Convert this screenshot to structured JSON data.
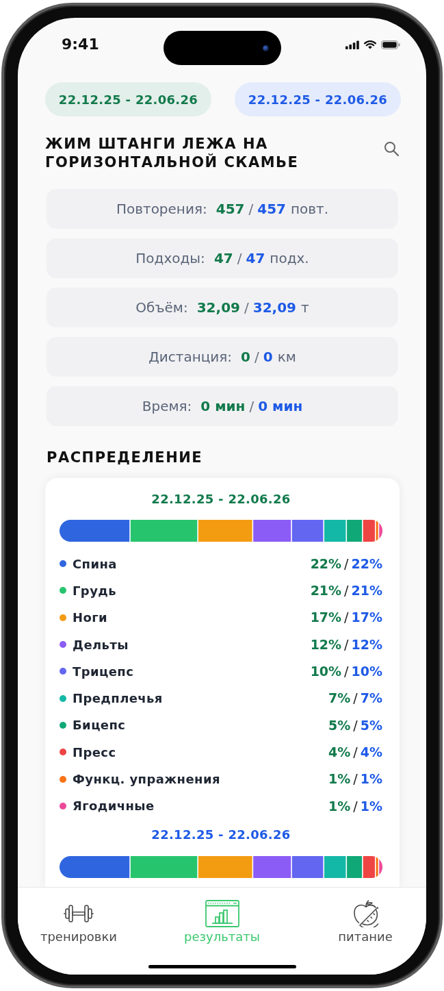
{
  "status_bar": {
    "time": "9:41"
  },
  "periods": [
    {
      "label": "22.12.25 - 22.06.26",
      "color": "#127a4c"
    },
    {
      "label": "22.12.25 - 22.06.26",
      "color": "#1e5ae6"
    }
  ],
  "exercise": {
    "title": "ЖИМ ШТАНГИ ЛЕЖА НА ГОРИЗОНТАЛЬНОЙ СКАМЬЕ"
  },
  "stats": [
    {
      "label": "Повторения:",
      "value_1": "457",
      "separator": "/",
      "value_2": "457",
      "unit": "повт."
    },
    {
      "label": "Подходы:",
      "value_1": "47",
      "separator": "/",
      "value_2": "47",
      "unit": "подх."
    },
    {
      "label": "Объём:",
      "value_1": "32,09",
      "separator": "/",
      "value_2": "32,09",
      "unit": "т"
    },
    {
      "label": "Дистанция:",
      "value_1": "0",
      "separator": "/",
      "value_2": "0",
      "unit": "км"
    },
    {
      "label": "Время:",
      "value_1": "0 мин",
      "separator": "/",
      "value_2": "0 мин"
    }
  ],
  "distribution": {
    "title": "РАСПРЕДЕЛЕНИЕ",
    "blocks": [
      {
        "date": "22.12.25 - 22.06.26"
      },
      {
        "date": "22.12.25 - 22.06.26"
      }
    ],
    "legend": [
      {
        "label": "Спина",
        "color": "#2f66e0",
        "value_1": "22%",
        "separator": "/",
        "value_2": "22%"
      },
      {
        "label": "Грудь",
        "color": "#27c46e",
        "value_1": "21%",
        "separator": "/",
        "value_2": "21%"
      },
      {
        "label": "Ноги",
        "color": "#f39c12",
        "value_1": "17%",
        "separator": "/",
        "value_2": "17%"
      },
      {
        "label": "Дельты",
        "color": "#8b5cf6",
        "value_1": "12%",
        "separator": "/",
        "value_2": "12%"
      },
      {
        "label": "Трицепс",
        "color": "#6366f1",
        "value_1": "10%",
        "separator": "/",
        "value_2": "10%"
      },
      {
        "label": "Предплечья",
        "color": "#14b8a6",
        "value_1": "7%",
        "separator": "/",
        "value_2": "7%"
      },
      {
        "label": "Бицепс",
        "color": "#10a877",
        "value_1": "5%",
        "separator": "/",
        "value_2": "5%"
      },
      {
        "label": "Пресс",
        "color": "#ef4444",
        "value_1": "4%",
        "separator": "/",
        "value_2": "4%"
      },
      {
        "label": "Функц. упражнения",
        "color": "#f97316",
        "value_1": "1%",
        "separator": "/",
        "value_2": "1%"
      },
      {
        "label": "Ягодичные",
        "color": "#ec4899",
        "value_1": "1%",
        "separator": "/",
        "value_2": "1%"
      }
    ]
  },
  "nav": [
    {
      "label": "тренировки",
      "selected": false
    },
    {
      "label": "результаты",
      "selected": true
    },
    {
      "label": "питание",
      "selected": false
    }
  ]
}
